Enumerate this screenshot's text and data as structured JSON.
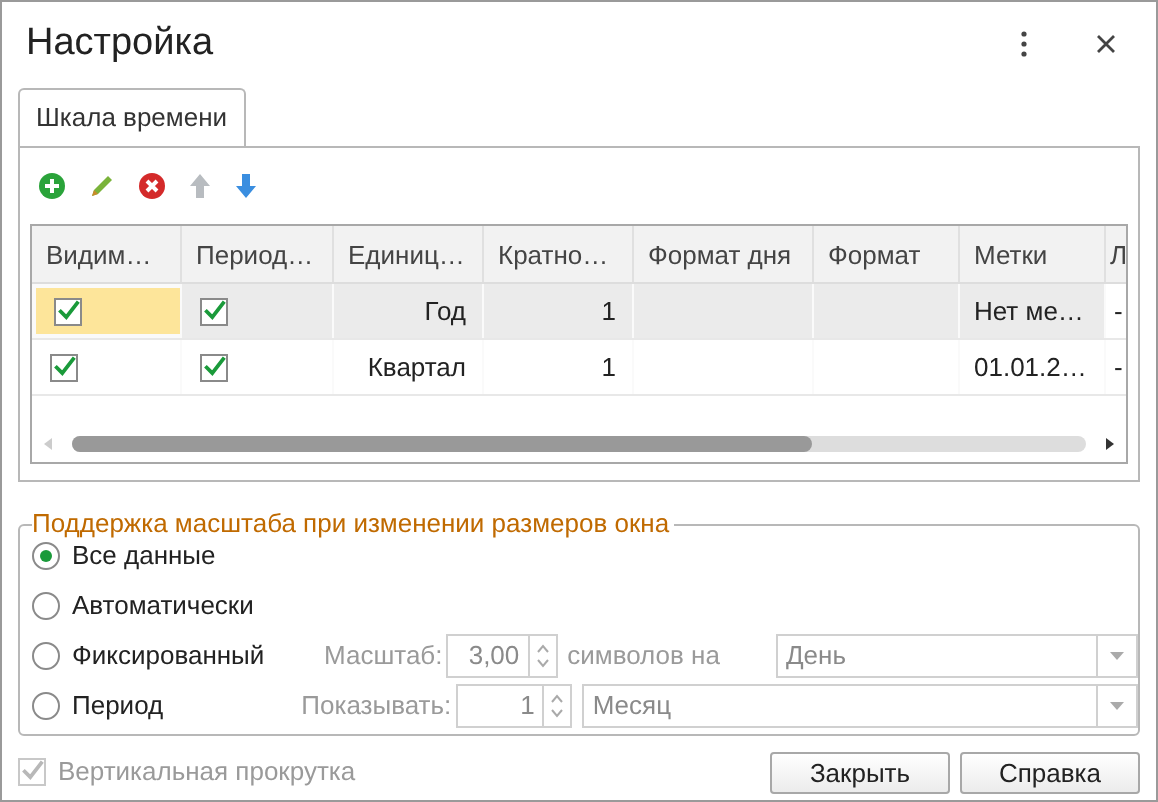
{
  "window": {
    "title": "Настройка"
  },
  "tabs": [
    {
      "label": "Шкала времени",
      "selected": true
    }
  ],
  "table": {
    "columns": [
      "Видим…",
      "Период…",
      "Единиц…",
      "Кратно…",
      "Формат дня",
      "Формат",
      "Метки",
      "Л"
    ],
    "rows": [
      {
        "selected": true,
        "visible": {
          "checked": true
        },
        "periodic": {
          "checked": true
        },
        "unit": "Год",
        "multiplicity": "1",
        "marks": "Нет ме…",
        "column_8": "-"
      },
      {
        "selected": false,
        "visible": {
          "checked": true
        },
        "periodic": {
          "checked": true
        },
        "unit": "Квартал",
        "multiplicity": "1",
        "marks": "01.01.2…",
        "column_8": "-"
      }
    ],
    "scroll_visible": true
  },
  "scale_group": {
    "title": "Поддержка масштаба при изменении размеров окна",
    "options": [
      {
        "label": "Все данные",
        "selected": true,
        "kind": "plain"
      },
      {
        "label": "Автоматически",
        "selected": false,
        "kind": "plain"
      },
      {
        "label": "Фиксированный",
        "selected": false,
        "kind": "scale",
        "field_label": "Масштаб:",
        "value": "3,00",
        "suffix": "символов на",
        "dropdown": "День",
        "disabled": true
      },
      {
        "label": "Период",
        "selected": false,
        "kind": "period",
        "field_label": "Показывать:",
        "value": "1",
        "dropdown": "Месяц",
        "disabled": true
      }
    ]
  },
  "vertical_scroll": {
    "label": "Вертикальная прокрутка",
    "checked": true,
    "disabled": true
  },
  "buttons": [
    "Закрыть",
    "Справка"
  ]
}
